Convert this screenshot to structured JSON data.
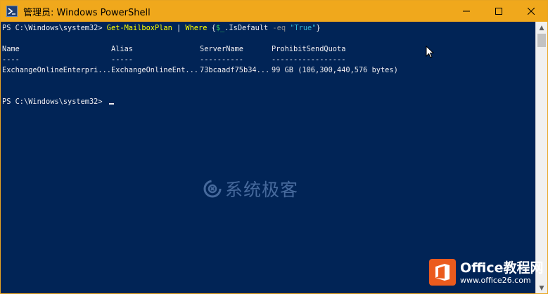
{
  "window": {
    "title": "管理员: Windows PowerShell",
    "accent_color": "#f0a81c",
    "console_background": "#012456"
  },
  "console": {
    "prompt": "PS C:\\Windows\\system32> ",
    "command": {
      "cmdlet": "Get-MailboxPlan",
      "pipe": " | ",
      "where": "Where",
      "brace_open": " {",
      "variable": "$_",
      "property": ".IsDefault",
      "operator": " -eq ",
      "value": "\"True\"",
      "brace_close": "}"
    },
    "headers": [
      "Name",
      "Alias",
      "ServerName",
      "ProhibitSendQuota"
    ],
    "separators": [
      "----",
      "-----",
      "----------",
      "-----------------"
    ],
    "rows": [
      [
        "ExchangeOnlineEnterpri...",
        "ExchangeOnlineEnt...",
        "73bcaadf75b34...",
        "99 GB (106,300,440,576 bytes)"
      ]
    ],
    "second_prompt": "PS C:\\Windows\\system32> "
  },
  "watermark": {
    "text": "系统极客",
    "icon": "swirl-logo-icon"
  },
  "branding": {
    "title": "Office教程网",
    "url": "www.office26.com",
    "icon": "office-logo-icon"
  },
  "icons": {
    "app": "powershell-icon",
    "minimize": "minimize-icon",
    "maximize": "maximize-icon",
    "close": "close-icon",
    "pointer": "mouse-pointer-icon"
  }
}
